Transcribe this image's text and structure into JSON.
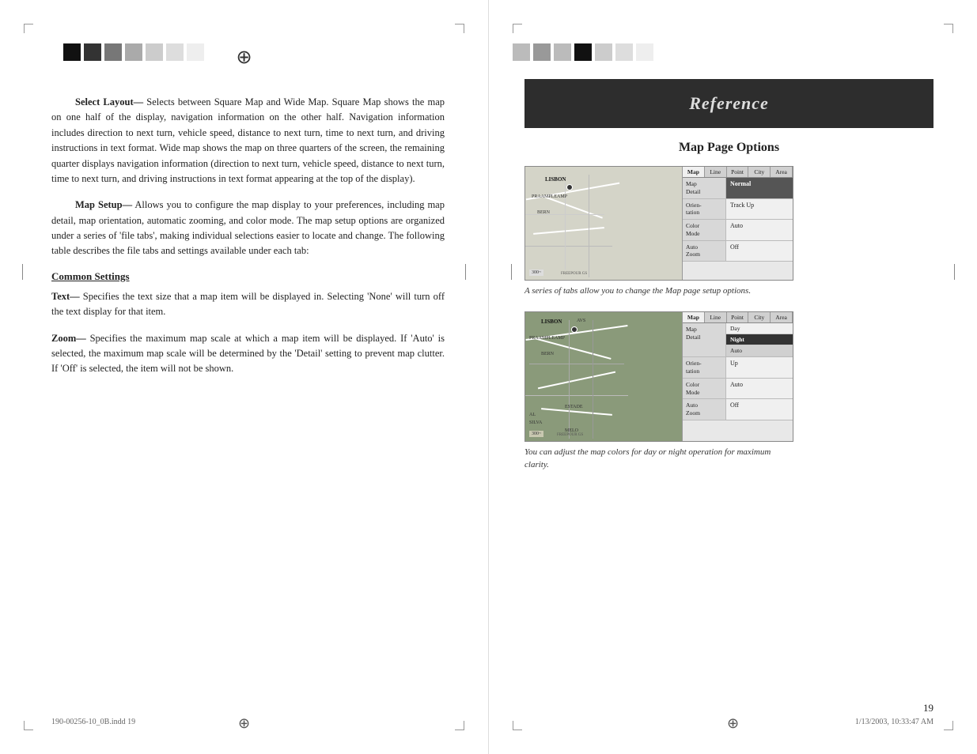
{
  "left_page": {
    "header_bars": [
      "#111",
      "#333",
      "#777",
      "#aaa",
      "#ccc",
      "#ddd",
      "#eee"
    ],
    "paragraphs": [
      {
        "id": "select-layout",
        "term": "Select Layout—",
        "text": " Selects between Square Map and Wide Map. Square Map shows the map on one half of the display, navigation information on the other half. Navigation information includes direction to next turn, vehicle speed, distance to next turn, time to next turn, and driving instructions in text format. Wide map shows the map on three quarters of the screen, the remaining quarter displays navigation information (direction to next turn, vehicle speed, distance to next turn, time to next turn, and driving instructions in text format appearing at the top of the display)."
      },
      {
        "id": "map-setup",
        "term": "Map Setup—",
        "text": " Allows you to configure the map display to your preferences, including map detail, map orientation, automatic zooming, and color mode. The map setup options are organized under a series of 'file tabs', making individual selections easier to locate and change. The following table describes the file tabs and settings available under each tab:"
      }
    ],
    "section_heading": "Common Settings",
    "sub_paragraphs": [
      {
        "id": "text-setting",
        "term": "Text—",
        "text": " Specifies the text size that a map item will be displayed in. Selecting 'None' will turn off the text display for that item."
      },
      {
        "id": "zoom-setting",
        "term": "Zoom—",
        "text": " Specifies the maximum map scale at which a map item will be displayed. If 'Auto' is selected, the maximum map scale will be determined by the 'Detail' setting to prevent map clutter. If 'Off' is selected, the item will not be shown."
      }
    ],
    "footer": {
      "left": "190-00256-10_0B.indd  19",
      "right": "1/13/2003, 10:33:47 AM"
    }
  },
  "right_page": {
    "header_bars": [
      "#bbb",
      "#999",
      "#bbb",
      "#111",
      "#ccc",
      "#ddd",
      "#eee"
    ],
    "banner": {
      "title": "Reference"
    },
    "section_title": "Map Page Options",
    "map1": {
      "tabs": [
        "Map",
        "Line",
        "Point",
        "City",
        "Area"
      ],
      "options": [
        {
          "label": "Map\nDetail",
          "value": "Normal",
          "selected": true
        },
        {
          "label": "Orien-\ntation",
          "value": "Track Up",
          "selected": false
        },
        {
          "label": "Color\nMode",
          "value": "Auto",
          "selected": false
        },
        {
          "label": "Auto\nZoom",
          "value": "Off",
          "selected": false
        }
      ],
      "caption": "A series of tabs allow you to change the Map page setup options."
    },
    "map2": {
      "tabs": [
        "Map",
        "Line",
        "Point",
        "City",
        "Area"
      ],
      "options": [
        {
          "label": "Map\nDetail",
          "value_top": "Day",
          "value_mid": "Night",
          "value_bot": "Auto",
          "multi": true
        },
        {
          "label": "Orien-\ntation",
          "value": "Up",
          "selected": false
        },
        {
          "label": "Color\nMode",
          "value": "Auto",
          "selected": false
        },
        {
          "label": "Auto\nZoom",
          "value": "Off",
          "selected": false
        }
      ],
      "caption": "You can adjust the map colors for day or night operation for maximum clarity."
    },
    "page_number": "19"
  }
}
